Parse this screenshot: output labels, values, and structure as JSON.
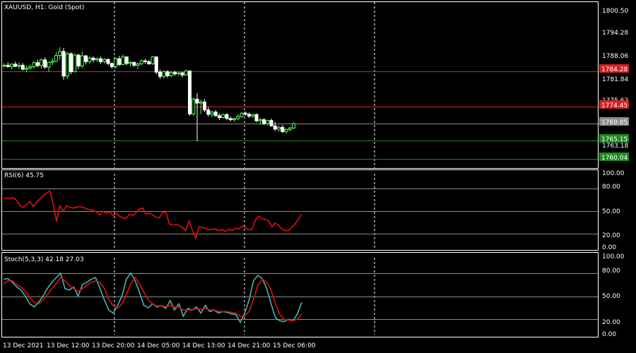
{
  "colors": {
    "background": "#000000",
    "frame": "#ffffff",
    "bull": "#55ff55",
    "bear": "#ffffff",
    "resistance": "#d42020",
    "support": "#1f8a1f",
    "current": "#8c8c8c",
    "rsi": "#e01010",
    "stoch_main": "#3fb6b6",
    "stoch_signal": "#e01010"
  },
  "main": {
    "title": "XAUUSD, H1:  Gold (Spot)",
    "price_ticks": [
      "1800.50",
      "1794.28",
      "1788.06",
      "1781.84",
      "1775.62",
      "1763.18"
    ],
    "tags": [
      {
        "label": "1784.28",
        "kind": "resistance"
      },
      {
        "label": "1774.45",
        "kind": "resistance"
      },
      {
        "label": "1769.85",
        "kind": "current"
      },
      {
        "label": "1765.15",
        "kind": "support"
      },
      {
        "label": "1760.04",
        "kind": "support"
      }
    ]
  },
  "rsi": {
    "title": "RSI(6) 45.75",
    "ticks": [
      "100.00",
      "80.00",
      "50.00",
      "20.00",
      "0.00"
    ]
  },
  "stoch": {
    "title": "Stoch(5,3,3) 42.18 27.03",
    "ticks": [
      "100.00",
      "80.00",
      "50.00",
      "20.00",
      "0.00"
    ]
  },
  "time_labels": [
    "13 Dec 2021",
    "13 Dec 12:00",
    "13 Dec 20:00",
    "14 Dec 05:00",
    "14 Dec 13:00",
    "14 Dec 21:00",
    "15 Dec 06:00"
  ],
  "chart_data": [
    {
      "type": "candlestick",
      "title": "XAUUSD, H1:  Gold (Spot)",
      "ylim": [
        1757.5,
        1803.5
      ],
      "yticks": [
        1800.5,
        1794.28,
        1788.06,
        1781.84,
        1775.62,
        1763.18
      ],
      "levels": [
        {
          "value": 1784.28,
          "kind": "resistance"
        },
        {
          "value": 1774.45,
          "kind": "resistance"
        },
        {
          "value": 1769.85,
          "kind": "current"
        },
        {
          "value": 1765.15,
          "kind": "support"
        },
        {
          "value": 1760.04,
          "kind": "support"
        }
      ],
      "ohlc": [
        [
          1785.8,
          1786.6,
          1785.2,
          1786.0
        ],
        [
          1786.0,
          1786.8,
          1785.3,
          1785.6
        ],
        [
          1785.6,
          1786.5,
          1784.8,
          1786.3
        ],
        [
          1786.3,
          1787.0,
          1785.5,
          1785.7
        ],
        [
          1785.7,
          1786.8,
          1785.0,
          1786.0
        ],
        [
          1786.0,
          1786.6,
          1784.5,
          1784.9
        ],
        [
          1784.9,
          1786.0,
          1784.0,
          1785.2
        ],
        [
          1785.2,
          1786.2,
          1784.8,
          1785.6
        ],
        [
          1785.6,
          1787.2,
          1785.0,
          1786.7
        ],
        [
          1786.7,
          1787.5,
          1785.4,
          1785.9
        ],
        [
          1785.9,
          1787.8,
          1785.1,
          1787.5
        ],
        [
          1787.5,
          1788.2,
          1785.0,
          1785.5
        ],
        [
          1785.5,
          1787.0,
          1784.2,
          1786.8
        ],
        [
          1786.8,
          1788.0,
          1786.0,
          1787.1
        ],
        [
          1787.1,
          1789.6,
          1786.9,
          1788.7
        ],
        [
          1788.7,
          1791.0,
          1787.5,
          1789.8
        ],
        [
          1789.8,
          1790.8,
          1782.0,
          1783.0
        ],
        [
          1783.0,
          1789.6,
          1782.2,
          1789.2
        ],
        [
          1789.2,
          1789.5,
          1783.5,
          1784.2
        ],
        [
          1784.2,
          1789.3,
          1784.0,
          1788.8
        ],
        [
          1788.8,
          1789.2,
          1785.0,
          1785.8
        ],
        [
          1785.8,
          1789.8,
          1785.2,
          1788.6
        ],
        [
          1788.6,
          1788.8,
          1786.2,
          1787.0
        ],
        [
          1787.0,
          1788.5,
          1786.4,
          1788.0
        ],
        [
          1788.0,
          1788.4,
          1786.8,
          1787.5
        ],
        [
          1787.5,
          1788.2,
          1786.9,
          1787.8
        ],
        [
          1787.8,
          1788.4,
          1786.4,
          1787.0
        ],
        [
          1787.0,
          1788.0,
          1786.5,
          1787.6
        ],
        [
          1787.6,
          1787.9,
          1786.0,
          1786.5
        ],
        [
          1786.5,
          1786.8,
          1785.0,
          1785.6
        ],
        [
          1785.6,
          1788.2,
          1785.1,
          1787.8
        ],
        [
          1787.8,
          1788.6,
          1785.8,
          1786.2
        ],
        [
          1786.2,
          1789.0,
          1786.0,
          1788.3
        ],
        [
          1788.3,
          1788.5,
          1786.0,
          1786.5
        ],
        [
          1786.5,
          1787.2,
          1785.6,
          1786.8
        ],
        [
          1786.8,
          1787.0,
          1785.5,
          1786.0
        ],
        [
          1786.0,
          1786.7,
          1785.0,
          1786.4
        ],
        [
          1786.4,
          1787.6,
          1786.0,
          1787.2
        ],
        [
          1787.2,
          1787.8,
          1786.4,
          1787.0
        ],
        [
          1787.0,
          1787.4,
          1786.1,
          1786.4
        ],
        [
          1786.4,
          1788.6,
          1786.1,
          1788.3
        ],
        [
          1788.3,
          1788.5,
          1783.5,
          1784.1
        ],
        [
          1784.1,
          1784.8,
          1782.2,
          1782.9
        ],
        [
          1782.9,
          1784.6,
          1782.3,
          1784.2
        ],
        [
          1784.2,
          1784.6,
          1782.5,
          1783.1
        ],
        [
          1783.1,
          1784.4,
          1782.7,
          1784.0
        ],
        [
          1784.0,
          1784.5,
          1783.1,
          1783.6
        ],
        [
          1783.6,
          1784.2,
          1783.0,
          1783.9
        ],
        [
          1783.9,
          1784.2,
          1782.6,
          1783.3
        ],
        [
          1783.3,
          1784.8,
          1783.0,
          1784.4
        ],
        [
          1784.4,
          1784.6,
          1772.0,
          1772.5
        ],
        [
          1772.5,
          1777.0,
          1772.0,
          1776.6
        ],
        [
          1776.6,
          1778.2,
          1765.0,
          1775.5
        ],
        [
          1775.5,
          1776.5,
          1772.5,
          1775.8
        ],
        [
          1775.8,
          1776.6,
          1773.0,
          1773.6
        ],
        [
          1773.6,
          1774.4,
          1771.8,
          1772.4
        ],
        [
          1772.4,
          1773.4,
          1771.6,
          1773.0
        ],
        [
          1773.0,
          1773.6,
          1771.8,
          1772.0
        ],
        [
          1772.0,
          1772.6,
          1770.8,
          1771.5
        ],
        [
          1771.5,
          1772.6,
          1771.2,
          1772.3
        ],
        [
          1772.3,
          1772.8,
          1770.9,
          1771.2
        ],
        [
          1771.2,
          1771.8,
          1770.4,
          1770.9
        ],
        [
          1770.9,
          1771.5,
          1770.3,
          1771.2
        ],
        [
          1771.2,
          1772.4,
          1770.8,
          1771.8
        ],
        [
          1771.8,
          1773.0,
          1771.4,
          1772.7
        ],
        [
          1772.7,
          1773.2,
          1772.0,
          1772.4
        ],
        [
          1772.4,
          1772.9,
          1771.4,
          1771.9
        ],
        [
          1771.9,
          1772.6,
          1771.4,
          1772.3
        ],
        [
          1772.3,
          1772.7,
          1770.2,
          1770.6
        ],
        [
          1770.6,
          1771.4,
          1769.5,
          1770.9
        ],
        [
          1770.9,
          1771.3,
          1769.4,
          1769.8
        ],
        [
          1769.8,
          1770.9,
          1769.3,
          1770.7
        ],
        [
          1770.7,
          1771.2,
          1769.0,
          1769.2
        ],
        [
          1769.2,
          1770.3,
          1767.8,
          1768.3
        ],
        [
          1768.3,
          1769.2,
          1767.5,
          1768.8
        ],
        [
          1768.8,
          1769.4,
          1767.2,
          1767.6
        ],
        [
          1767.6,
          1768.5,
          1767.0,
          1768.2
        ],
        [
          1768.2,
          1769.0,
          1767.6,
          1768.6
        ],
        [
          1768.6,
          1770.2,
          1768.3,
          1769.8
        ]
      ]
    },
    {
      "type": "line",
      "title": "RSI(6) 45.75",
      "ylim": [
        0,
        100
      ],
      "yticks": [
        100,
        80,
        50,
        20,
        0
      ],
      "series": [
        {
          "name": "RSI(6)",
          "values": [
            67,
            67,
            67,
            68,
            64,
            57,
            55,
            59,
            63,
            56,
            62,
            66,
            71,
            74,
            77,
            59,
            36,
            57,
            50,
            57,
            55,
            54,
            55,
            56,
            55,
            53,
            52,
            51,
            49,
            45,
            50,
            47,
            49,
            44,
            47,
            43,
            41,
            40,
            46,
            44,
            48,
            53,
            54,
            46,
            47,
            45,
            42,
            41,
            48,
            49,
            33,
            31,
            32,
            31,
            28,
            24,
            37,
            24,
            14,
            29,
            28,
            27,
            25,
            26,
            26,
            24,
            25,
            23,
            26,
            24,
            27,
            26,
            30,
            28,
            25,
            26,
            38,
            43,
            40,
            39,
            37,
            29,
            34,
            31,
            26,
            24,
            24,
            28,
            33,
            39,
            46
          ]
        }
      ]
    },
    {
      "type": "line",
      "title": "Stoch(5,3,3) 42.18 27.03",
      "ylim": [
        0,
        100
      ],
      "yticks": [
        100,
        80,
        50,
        20,
        0
      ],
      "series": [
        {
          "name": "main",
          "values": [
            72,
            73,
            68,
            62,
            58,
            50,
            40,
            36,
            42,
            50,
            60,
            68,
            74,
            80,
            60,
            58,
            62,
            50,
            65,
            68,
            72,
            74,
            60,
            45,
            32,
            28,
            38,
            50,
            72,
            80,
            70,
            55,
            38,
            35,
            40,
            36,
            38,
            34,
            44,
            32,
            40,
            24,
            34,
            32,
            36,
            28,
            38,
            30,
            32,
            28,
            30,
            29,
            27,
            26,
            16,
            28,
            45,
            70,
            77,
            73,
            60,
            40,
            22,
            18,
            17,
            20,
            18,
            27,
            42
          ]
        },
        {
          "name": "signal",
          "values": [
            66,
            70,
            70,
            65,
            62,
            56,
            48,
            42,
            40,
            45,
            52,
            60,
            66,
            74,
            70,
            64,
            60,
            56,
            60,
            64,
            68,
            70,
            68,
            60,
            46,
            38,
            34,
            40,
            52,
            66,
            74,
            66,
            55,
            45,
            40,
            37,
            38,
            36,
            38,
            36,
            36,
            32,
            32,
            32,
            34,
            33,
            34,
            32,
            32,
            30,
            30,
            30,
            29,
            28,
            24,
            24,
            30,
            46,
            64,
            72,
            68,
            58,
            40,
            26,
            20,
            19,
            18,
            20,
            27
          ]
        }
      ]
    }
  ]
}
